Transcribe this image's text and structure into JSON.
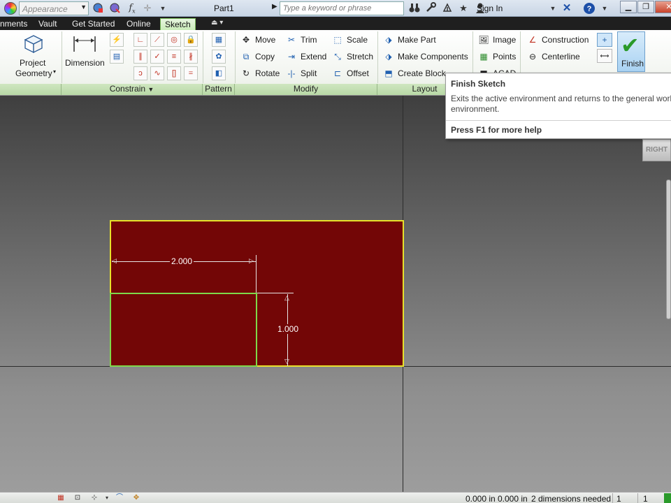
{
  "titlebar": {
    "appearance": "Appearance",
    "document_title": "Part1",
    "search_placeholder": "Type a keyword or phrase",
    "sign_in": "Sign In",
    "fx_symbol": "f",
    "fx_sub": "x"
  },
  "tabs": [
    "nments",
    "Vault",
    "Get Started",
    "Online",
    "Sketch"
  ],
  "ribbon": {
    "draw_panel": {
      "project_geometry_line1": "Project",
      "project_geometry_line2": "Geometry"
    },
    "constrain_panel": {
      "dimension": "Dimension",
      "title": "Constrain"
    },
    "pattern_panel": {
      "title": "Pattern"
    },
    "modify_panel": {
      "title": "Modify",
      "move": "Move",
      "copy": "Copy",
      "rotate": "Rotate",
      "trim": "Trim",
      "extend": "Extend",
      "split": "Split",
      "scale": "Scale",
      "stretch": "Stretch",
      "offset": "Offset"
    },
    "layout_panel": {
      "title": "Layout",
      "make_part": "Make Part",
      "make_components": "Make Components",
      "create_block": "Create Block"
    },
    "insert_panel": {
      "image": "Image",
      "points": "Points",
      "acad": "ACAD"
    },
    "format_panel": {
      "construction": "Construction",
      "centerline": "Centerline"
    },
    "finish_sketch": "Finish"
  },
  "tooltip": {
    "title": "Finish Sketch",
    "description": "Exits the active environment and returns to the general work environment.",
    "help": "Press F1 for more help"
  },
  "viewcube": {
    "face": "RIGHT"
  },
  "sketch": {
    "dim_horizontal": "2.000",
    "dim_vertical": "1.000",
    "colors": {
      "region_fill": "#730606",
      "outer_border": "#e7e12a",
      "inner_border": "#7ed84a"
    }
  },
  "statusbar": {
    "x_coord": "0.000 in",
    "y_coord": "0.000 in",
    "dims_needed": "2 dimensions needed",
    "count_1": "1",
    "count_2": "1"
  }
}
